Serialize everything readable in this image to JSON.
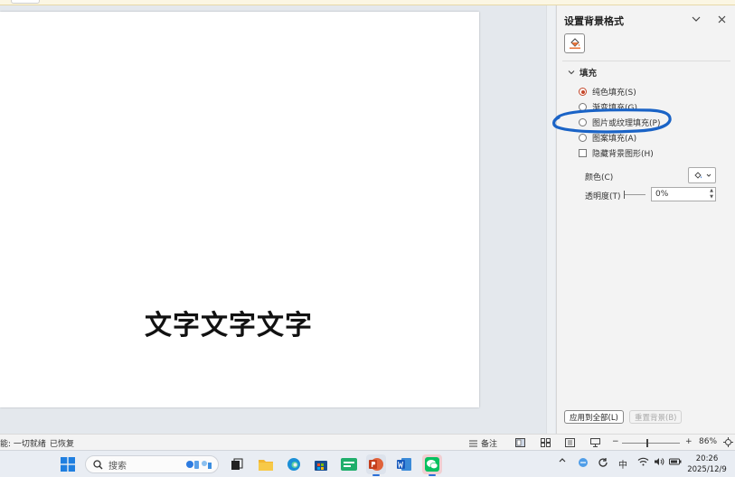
{
  "pane": {
    "title": "设置背景格式",
    "fill_section": "填充",
    "options": [
      {
        "label": "纯色填充(S)",
        "selected": true
      },
      {
        "label": "渐变填充(G)",
        "selected": false
      },
      {
        "label": "图片或纹理填充(P)",
        "selected": false
      },
      {
        "label": "图案填充(A)",
        "selected": false
      }
    ],
    "hide_bg_label": "隐藏背景图形(H)",
    "color_label": "颜色(C)",
    "transparency_label": "透明度(T)",
    "transparency_value": "0%",
    "apply_all_label": "应用到全部(L)",
    "reset_label": "重置背景(B)",
    "highlight_color": "#1a63c6"
  },
  "slide": {
    "text": "文字文字文字"
  },
  "statusbar": {
    "left_text": "能: 一切就绪",
    "restore_text": "已恢复",
    "notes_label": "备注",
    "zoom_minus": "−",
    "zoom_plus": "+",
    "zoom_value": "86%"
  },
  "taskbar": {
    "search_placeholder": "搜索",
    "ime": "中",
    "time": "20:26",
    "date": "2025/12/9",
    "accent": "#2b6fd6"
  }
}
